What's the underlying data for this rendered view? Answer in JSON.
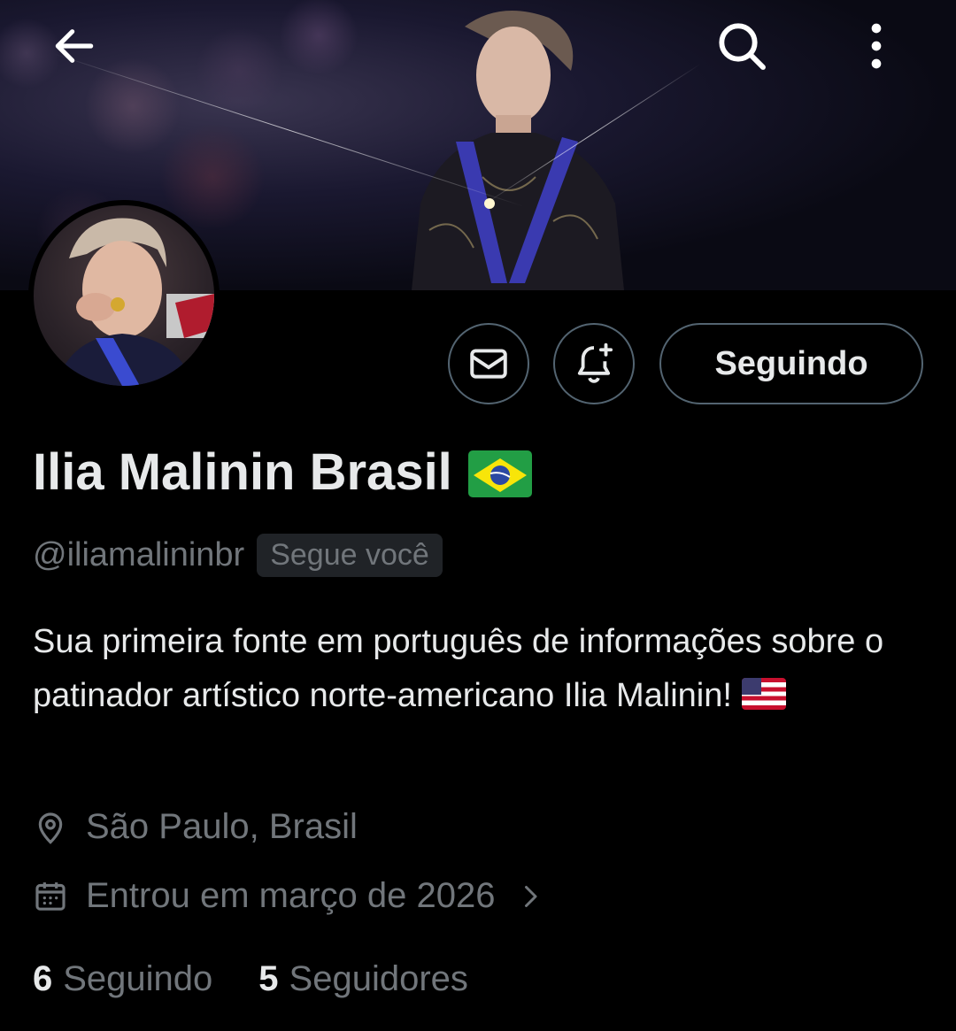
{
  "header": {
    "back_icon": "arrow-left-icon",
    "search_icon": "search-icon",
    "more_icon": "more-vertical-icon"
  },
  "profile": {
    "name": "Ilia Malinin Brasil",
    "name_flag": "brazil-flag",
    "handle": "@iliamalininbr",
    "follows_you": "Segue você",
    "bio_text": "Sua primeira fonte em português de informações sobre o patinador artístico norte-americano Ilia Malinin!",
    "bio_flag": "us-flag",
    "location": "São Paulo, Brasil",
    "joined": "Entrou em março de 2026"
  },
  "actions": {
    "message_icon": "mail-icon",
    "notify_icon": "bell-plus-icon",
    "follow_label": "Seguindo"
  },
  "stats": {
    "following_count": "6",
    "following_label": "Seguindo",
    "followers_count": "5",
    "followers_label": "Seguidores"
  },
  "colors": {
    "background": "#000000",
    "text_primary": "#e7e9ea",
    "text_secondary": "#71767b",
    "border": "#536471"
  }
}
